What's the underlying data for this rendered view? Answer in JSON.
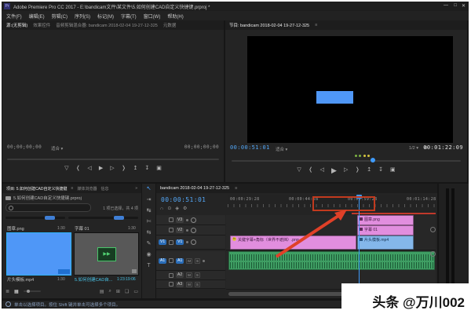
{
  "window": {
    "app_icon_text": "Pr",
    "title": "Adobe Premiere Pro CC 2017 - E:\\bandicam文件\\某文件\\5.如何创建CAD自定义快捷键.prproj *",
    "minimize": "—",
    "maximize": "□",
    "close": "✕"
  },
  "menu": {
    "items": [
      {
        "label": "文件(F)"
      },
      {
        "label": "编辑(E)"
      },
      {
        "label": "剪辑(C)"
      },
      {
        "label": "序列(S)"
      },
      {
        "label": "标记(M)"
      },
      {
        "label": "字幕(T)"
      },
      {
        "label": "窗口(W)"
      },
      {
        "label": "帮助(H)"
      }
    ]
  },
  "monitor_tabs": {
    "source_group": [
      {
        "label": "源:(无剪辑)"
      },
      {
        "label": "效果控件"
      },
      {
        "label": "音频剪辑混合器: bandicam 2018-02-04 19-27-12-325"
      },
      {
        "label": "元数据"
      }
    ],
    "program": "节目: bandicam 2018-02-04 19-27-12-325",
    "panel_menu": "≡"
  },
  "source_monitor": {
    "timecode_left": "00;00;00;00",
    "zoom_level": "适合",
    "caret": "▾",
    "timecode_right": "00;00;00;00"
  },
  "program_monitor": {
    "timecode_current": "00:00:51:01",
    "zoom_level": "适合",
    "caret": "▾",
    "playback_resolution": "1/2",
    "settings_icon": "⚙",
    "timecode_duration": "00:01:22:09",
    "transport": {
      "add_marker": "▽",
      "go_in": "❬",
      "step_back": "◁",
      "play": "▶",
      "step_fwd": "▷",
      "go_out": "❭",
      "lift": "↥",
      "extract": "↧",
      "export_frame": "▣"
    }
  },
  "project_panel": {
    "tabs": [
      {
        "label": "项目: 5.如何创建CAD自定义快捷键"
      },
      {
        "label": "媒体浏览器"
      },
      {
        "label": "信息"
      }
    ],
    "overflow": "»",
    "panel_menu": "≡",
    "file_name": "5.如何创建CAD自定义快捷键.prproj",
    "selection_info": "1 项已选择，共 4 项",
    "items": [
      {
        "name": "图章.png",
        "duration": "1:30"
      },
      {
        "name": "字幕 01",
        "duration": "1:30"
      },
      {
        "name": "片头模板.mp4",
        "duration": "1:30"
      },
      {
        "name": "5.如何创建CAD自...",
        "duration": "1:23:19:06"
      }
    ],
    "toolbar": {
      "list_view": "≣",
      "icon_view": "▦",
      "bin_icon": "▤",
      "find_icon": "⌕",
      "new_bin_icon": "⊞",
      "new_item_icon": "❏",
      "delete_icon": "▭"
    }
  },
  "tools": {
    "items": [
      {
        "name": "selection-tool",
        "glyph": "↖"
      },
      {
        "name": "track-select-forward-tool",
        "glyph": "⇥"
      },
      {
        "name": "ripple-edit-tool",
        "glyph": "↹"
      },
      {
        "name": "razor-tool",
        "glyph": "✄"
      },
      {
        "name": "slip-tool",
        "glyph": "⇆"
      },
      {
        "name": "pen-tool",
        "glyph": "✎"
      },
      {
        "name": "hand-tool",
        "glyph": "◉"
      },
      {
        "name": "type-tool",
        "glyph": "T"
      }
    ]
  },
  "timeline": {
    "tab": "bandicam 2018-02-04 19-27-12-325",
    "panel_menu": "≡",
    "timecode": "00:00:51:01",
    "toolbar_icons": {
      "snap": "∩",
      "linked_selection": "⊙",
      "add_marker": "◈",
      "settings": "⚙"
    },
    "ruler_labels": [
      {
        "t": "00:00:29:28"
      },
      {
        "t": "00:00:44:28"
      },
      {
        "t": "00:00:59:28"
      },
      {
        "t": "00:01:14:28"
      }
    ],
    "source_patch_video": "V1",
    "source_patch_audio": "A1",
    "tracks": {
      "v3": "V3",
      "v2": "V2",
      "v1": "V1",
      "a1": "A1",
      "a2": "A2",
      "a3": "A3"
    },
    "mute": "M",
    "solo": "S",
    "fx": "fx",
    "clips": {
      "stamp": "图章.png",
      "subtitle": "字幕 01",
      "key_subtitle": "关键字幕+角标（世界不遮挡）.png",
      "opener": "片头模板.mp4"
    }
  },
  "status_bar": {
    "hint": "单击以选择项目。按住 Shift 键并单击可选择多个项目。"
  },
  "watermark": {
    "text": "头条 @万川002"
  },
  "colors": {
    "accent_blue": "#3f9bfa",
    "timecode_blue": "#53a7f7",
    "clip_pink": "#e18ede",
    "clip_blue": "#84b7ea",
    "clip_green": "#3f9e63",
    "thumb_blue": "#4f97f7",
    "annotation_red": "#d93a22"
  }
}
